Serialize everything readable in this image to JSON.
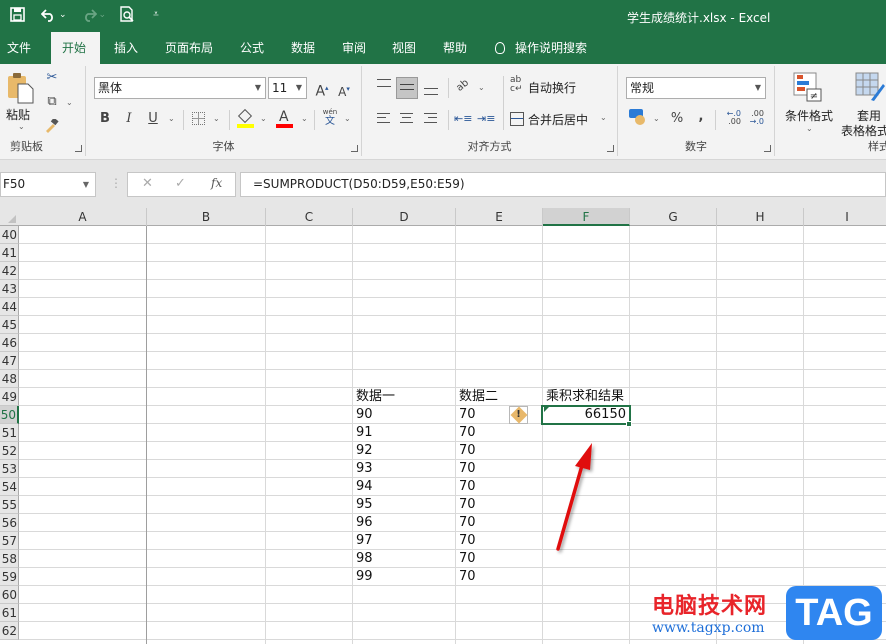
{
  "titlebar": {
    "document_title": "学生成绩统计.xlsx  -  Excel",
    "qat": {
      "save_icon": "save-icon",
      "undo_icon": "undo-icon",
      "redo_icon": "redo-icon",
      "print_preview_icon": "print-preview-icon",
      "customize_icon": "customize-qat-icon"
    }
  },
  "tabs": [
    {
      "label": "文件",
      "active": false
    },
    {
      "label": "开始",
      "active": true
    },
    {
      "label": "插入",
      "active": false
    },
    {
      "label": "页面布局",
      "active": false
    },
    {
      "label": "公式",
      "active": false
    },
    {
      "label": "数据",
      "active": false
    },
    {
      "label": "审阅",
      "active": false
    },
    {
      "label": "视图",
      "active": false
    },
    {
      "label": "帮助",
      "active": false
    }
  ],
  "tell_me": {
    "label": "操作说明搜索",
    "icon": "lightbulb-icon"
  },
  "ribbon": {
    "clipboard": {
      "label": "剪贴板",
      "paste_label": "粘贴",
      "cut_icon": "scissors-icon",
      "copy_icon": "copy-icon",
      "format_painter_icon": "format-painter-icon"
    },
    "font": {
      "label": "字体",
      "font_name": "黑体",
      "font_size": "11",
      "increase_font": "A",
      "decrease_font": "A",
      "bold": "B",
      "italic": "I",
      "underline": "U",
      "phonetic_top": "wén",
      "phonetic_bottom": "文",
      "fill_color": "#ffff00",
      "font_color": "#ff0000"
    },
    "alignment": {
      "label": "对齐方式",
      "wrap_text": "自动换行",
      "merge_center": "合并后居中"
    },
    "number": {
      "label": "数字",
      "format": "常规",
      "percent": "%",
      "comma": ",",
      "inc_decimal_top": "←.0",
      "inc_decimal_bottom": ".00",
      "dec_decimal_top": ".00",
      "dec_decimal_bottom": "→.0"
    },
    "styles": {
      "label": "样式",
      "conditional_format": "条件格式",
      "format_as_table_1": "套用",
      "format_as_table_2": "表格格式"
    }
  },
  "formula_bar": {
    "name_box": "F50",
    "cancel": "✕",
    "enter": "✓",
    "fx": "fx",
    "formula": "=SUMPRODUCT(D50:D59,E50:E59)"
  },
  "sheet": {
    "columns": [
      "A",
      "B",
      "C",
      "D",
      "E",
      "F",
      "G",
      "H",
      "I"
    ],
    "selected_column": "F",
    "selected_row": "50",
    "rows": [
      "40",
      "41",
      "42",
      "43",
      "44",
      "45",
      "46",
      "47",
      "48",
      "49",
      "50",
      "51",
      "52",
      "53",
      "54",
      "55",
      "56",
      "57",
      "58",
      "59",
      "60",
      "61",
      "62"
    ],
    "header_row": {
      "D": "数据一",
      "E": "数据二",
      "F": "乘积求和结果"
    },
    "data": [
      {
        "row": "50",
        "D": "90",
        "E": "70",
        "F": "66150"
      },
      {
        "row": "51",
        "D": "91",
        "E": "70"
      },
      {
        "row": "52",
        "D": "92",
        "E": "70"
      },
      {
        "row": "53",
        "D": "93",
        "E": "70"
      },
      {
        "row": "54",
        "D": "94",
        "E": "70"
      },
      {
        "row": "55",
        "D": "95",
        "E": "70"
      },
      {
        "row": "56",
        "D": "96",
        "E": "70"
      },
      {
        "row": "57",
        "D": "97",
        "E": "70"
      },
      {
        "row": "58",
        "D": "98",
        "E": "70"
      },
      {
        "row": "59",
        "D": "99",
        "E": "70"
      }
    ],
    "error_indicator": "!"
  },
  "colors": {
    "excel_green": "#217346",
    "annotation_arrow": "#e01010"
  },
  "watermark": {
    "cn_text": "电脑技术网",
    "url": "www.tagxp.com",
    "tag": "TAG"
  }
}
